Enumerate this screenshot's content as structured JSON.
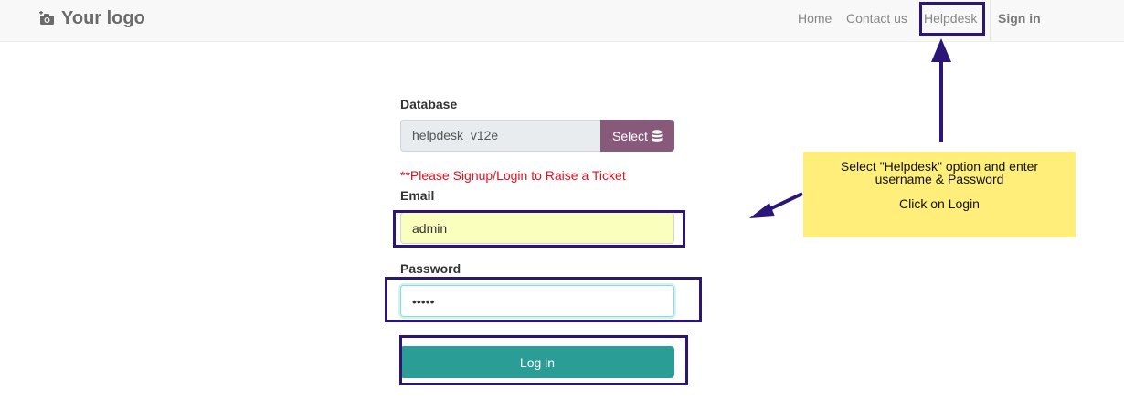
{
  "header": {
    "logo_text": "Your logo",
    "logo_icon": "camera-icon",
    "nav": {
      "home": "Home",
      "contact": "Contact us",
      "helpdesk": "Helpdesk",
      "signin": "Sign in"
    }
  },
  "form": {
    "database": {
      "label": "Database",
      "value": "helpdesk_v12e",
      "select_label": "Select",
      "select_icon": "database-icon"
    },
    "alert": "**Please Signup/Login to Raise a Ticket",
    "email": {
      "label": "Email",
      "value": "admin"
    },
    "password": {
      "label": "Password",
      "value": "•••••"
    },
    "login_label": "Log in"
  },
  "annotation": {
    "note_line1": "Select \"Helpdesk\" option and enter username & Password",
    "note_line2": "Click on Login",
    "highlight_color": "#2b1677",
    "note_color": "#ffee7a"
  },
  "colors": {
    "select_button": "#875a7b",
    "login_button": "#2a9d97",
    "alert_text": "#e0111f",
    "autofill_bg": "#faffbd"
  }
}
